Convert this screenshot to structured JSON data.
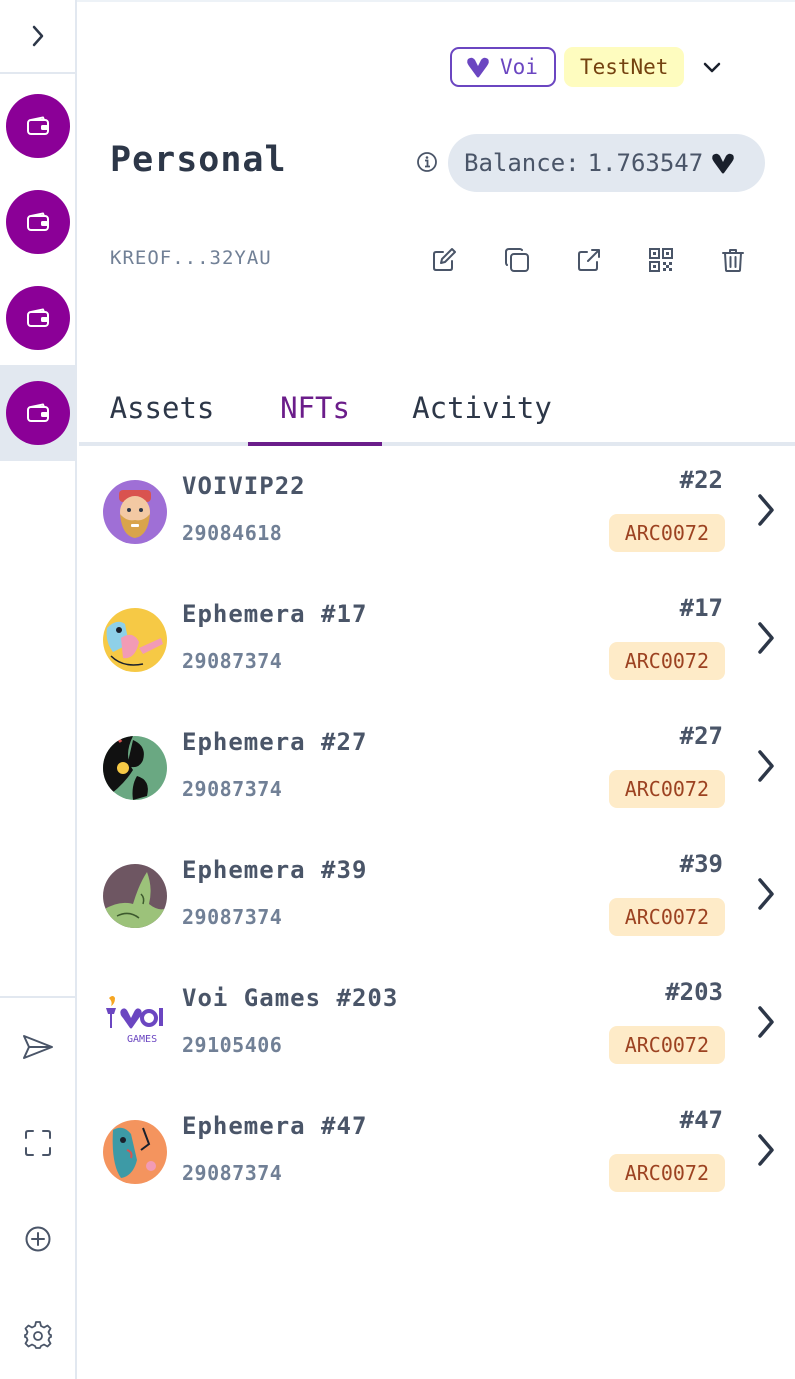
{
  "sidebar": {
    "toggle_icon": "chevron-right-icon",
    "accounts": [
      {
        "icon": "wallet-icon",
        "color": "#8b0097",
        "active": false
      },
      {
        "icon": "wallet-icon",
        "color": "#8b0097",
        "active": false
      },
      {
        "icon": "wallet-icon",
        "color": "#8b0097",
        "active": false
      },
      {
        "icon": "wallet-icon",
        "color": "#8b0097",
        "active": true
      }
    ],
    "bottom_icons": [
      "send-icon",
      "scan-icon",
      "add-circle-icon",
      "settings-gear-icon"
    ]
  },
  "network": {
    "name": "Voi",
    "icon": "voi-logo-icon",
    "accent": "#6b46c1",
    "environment": "TestNet",
    "environment_bg": "#fefcbf"
  },
  "account": {
    "name": "Personal",
    "balance_label": "Balance:",
    "balance_value": "1.763547",
    "balance_icon": "voi-logo-icon",
    "address": "KREOF...32YAU",
    "actions": [
      "edit-icon",
      "copy-icon",
      "external-link-icon",
      "qr-code-icon",
      "trash-icon"
    ]
  },
  "tabs": [
    {
      "label": "Assets",
      "active": false
    },
    {
      "label": "NFTs",
      "active": true
    },
    {
      "label": "Activity",
      "active": false
    }
  ],
  "nfts": [
    {
      "name": "VOIVIP22",
      "app_id": "29084618",
      "number": "#22",
      "standard": "ARC0072",
      "thumb": "bearded-avatar"
    },
    {
      "name": "Ephemera #17",
      "app_id": "29087374",
      "number": "#17",
      "standard": "ARC0072",
      "thumb": "ephemera-yellow"
    },
    {
      "name": "Ephemera #27",
      "app_id": "29087374",
      "number": "#27",
      "standard": "ARC0072",
      "thumb": "ephemera-green"
    },
    {
      "name": "Ephemera #39",
      "app_id": "29087374",
      "number": "#39",
      "standard": "ARC0072",
      "thumb": "ephemera-mauve"
    },
    {
      "name": "Voi Games #203",
      "app_id": "29105406",
      "number": "#203",
      "standard": "ARC0072",
      "thumb": "voi-games-logo"
    },
    {
      "name": "Ephemera #47",
      "app_id": "29087374",
      "number": "#47",
      "standard": "ARC0072",
      "thumb": "ephemera-orange"
    }
  ],
  "colors": {
    "brand_purple": "#8b0097",
    "tab_active": "#6b1d8a",
    "badge_bg": "#feebc8",
    "badge_text": "#9c4221"
  }
}
